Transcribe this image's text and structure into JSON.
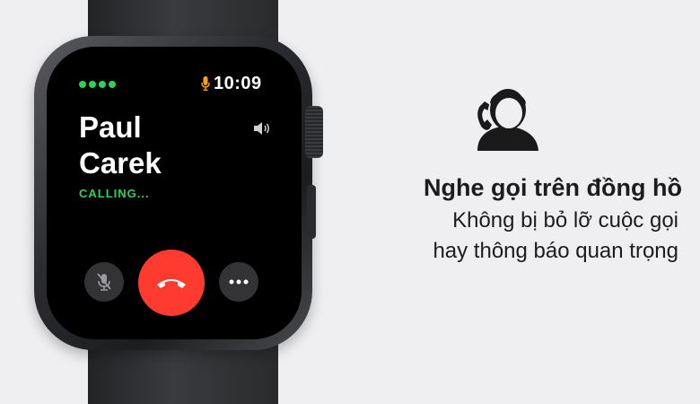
{
  "watch": {
    "status_dots": 4,
    "time": "10:09",
    "caller_first": "Paul",
    "caller_last": "Carek",
    "call_status": "CALLING...",
    "icons": {
      "mic_indicator": "microphone-icon",
      "speaker": "speaker-icon",
      "mute": "mute-microphone-icon",
      "end_call": "end-call-icon",
      "more": "more-options-icon"
    },
    "colors": {
      "accent_green": "#30d158",
      "end_call_red": "#ff3b30",
      "mic_orange": "#ff9f0a"
    }
  },
  "promo": {
    "icon": "person-phone-icon",
    "headline": "Nghe gọi trên đồng hồ",
    "line1": "Không bị bỏ lỡ cuộc gọi",
    "line2": "hay thông báo quan trọng"
  }
}
